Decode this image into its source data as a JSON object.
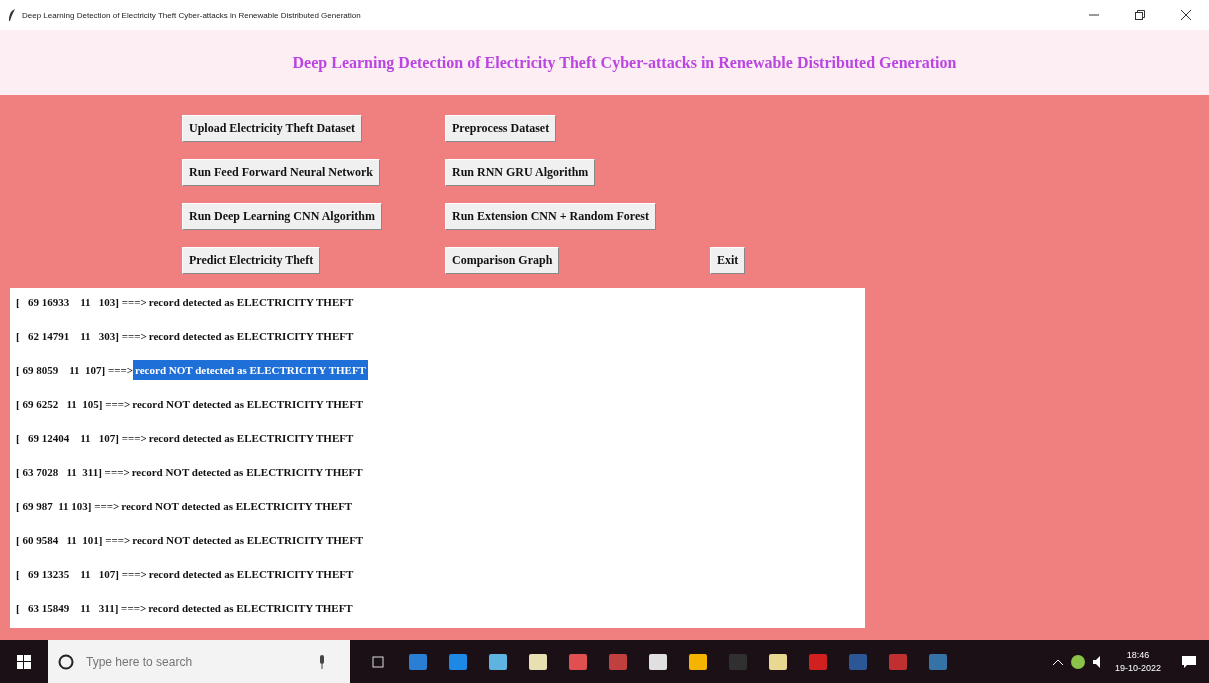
{
  "window": {
    "title": "Deep Learning Detection of Electricity Theft Cyber-attacks in Renewable Distributed Generation"
  },
  "heading": "Deep Learning Detection of Electricity Theft Cyber-attacks in Renewable Distributed Generation",
  "button_rows": [
    [
      "Upload Electricity Theft Dataset",
      "Preprocess Dataset"
    ],
    [
      "Run Feed Forward Neural Network",
      "Run RNN GRU Algorithm"
    ],
    [
      "Run Deep Learning CNN Algorithm",
      "Run Extension CNN + Random Forest"
    ],
    [
      "Predict Electricity Theft",
      "Comparison Graph",
      "Exit"
    ]
  ],
  "output_lines": [
    {
      "record": "[   69 16933    11   103] ===>",
      "result": "record detected as ELECTRICITY THEFT",
      "selected": false
    },
    {
      "record": "[   62 14791    11   303] ===>",
      "result": "record detected as ELECTRICITY THEFT",
      "selected": false
    },
    {
      "record": "[ 69 8059    11  107] ===>",
      "result": "record NOT detected as ELECTRICITY THEFT",
      "selected": true
    },
    {
      "record": "[ 69 6252   11  105] ===>",
      "result": "record NOT detected as ELECTRICITY THEFT",
      "selected": false
    },
    {
      "record": "[   69 12404    11   107] ===>",
      "result": "record detected as ELECTRICITY THEFT",
      "selected": false
    },
    {
      "record": "[ 63 7028   11  311] ===>",
      "result": "record NOT detected as ELECTRICITY THEFT",
      "selected": false
    },
    {
      "record": "[ 69 987  11 103] ===>",
      "result": "record NOT detected as ELECTRICITY THEFT",
      "selected": false
    },
    {
      "record": "[ 60 9584   11  101] ===>",
      "result": "record NOT detected as ELECTRICITY THEFT",
      "selected": false
    },
    {
      "record": "[   69 13235    11   107] ===>",
      "result": "record detected as ELECTRICITY THEFT",
      "selected": false
    },
    {
      "record": "[   63 15849    11   311] ===>",
      "result": "record detected as ELECTRICITY THEFT",
      "selected": false
    }
  ],
  "taskbar": {
    "search": {
      "placeholder": "Type here to search"
    },
    "apps": [
      {
        "color": "#2a7fd4"
      },
      {
        "color": "#1e88e5"
      },
      {
        "color": "#5fb3e0"
      },
      {
        "color": "#e8e0b0"
      },
      {
        "color": "#e05050"
      },
      {
        "color": "#c04040"
      },
      {
        "color": "#e0e0e0"
      },
      {
        "color": "#f4b400"
      },
      {
        "color": "#303030"
      },
      {
        "color": "#e8d890"
      },
      {
        "color": "#d02020"
      },
      {
        "color": "#2b5797"
      },
      {
        "color": "#c03030"
      },
      {
        "color": "#3572a5"
      }
    ],
    "time": "18:46",
    "date": "19-10-2022"
  }
}
